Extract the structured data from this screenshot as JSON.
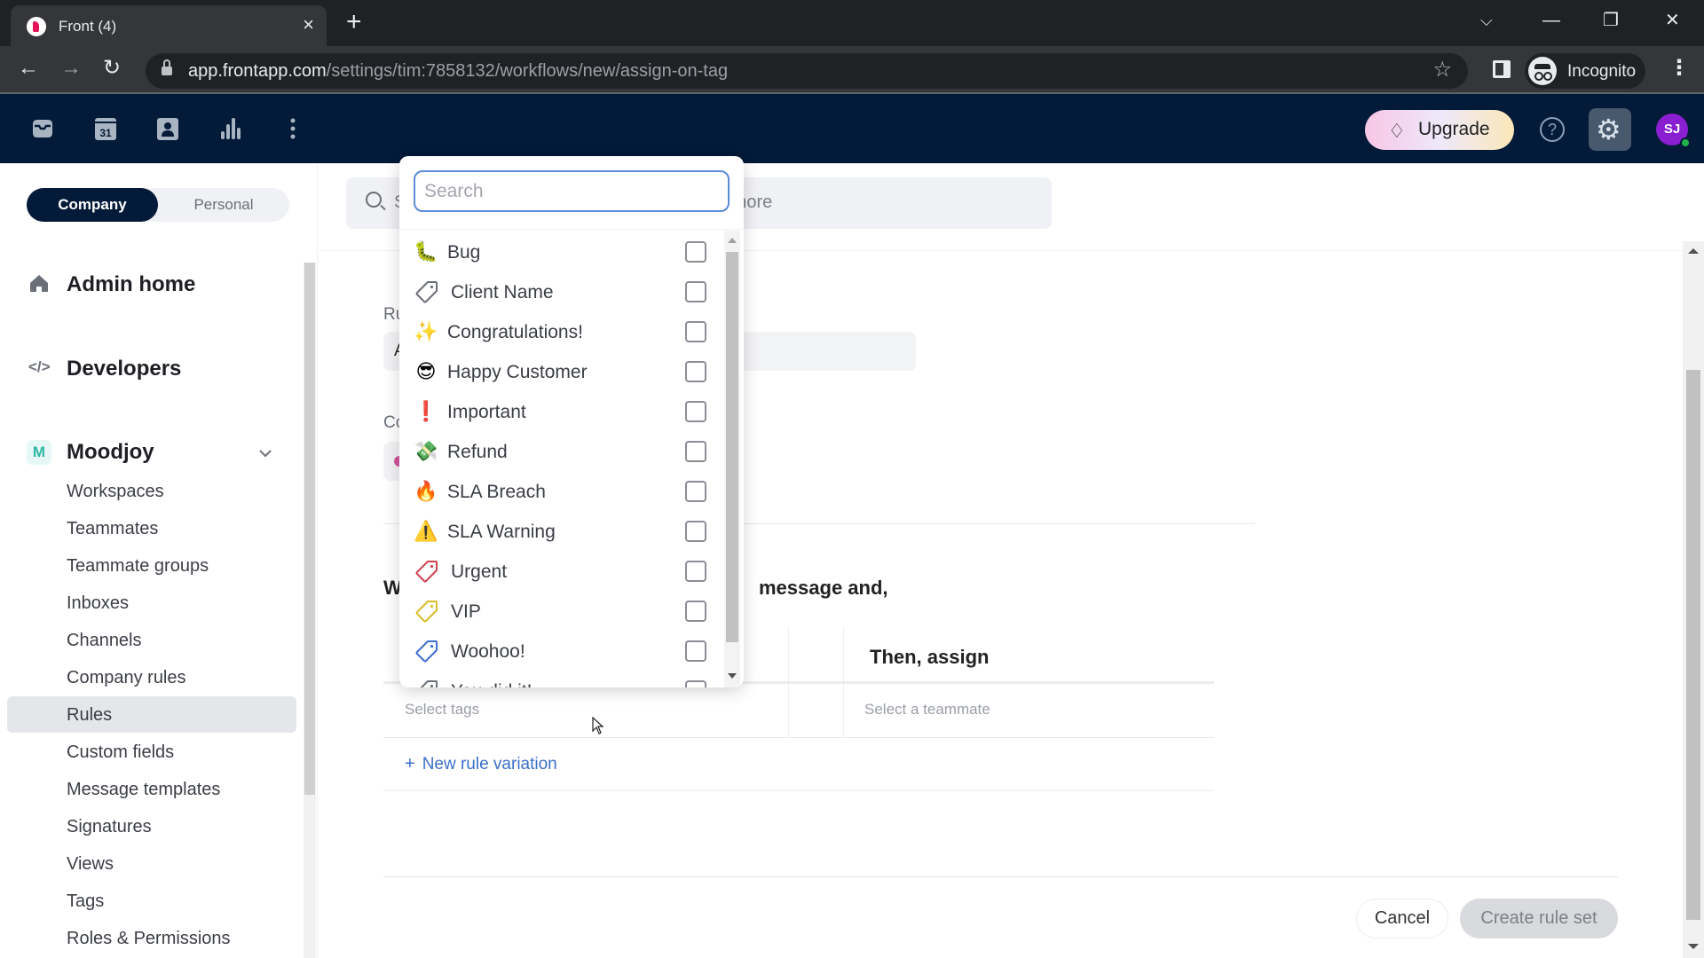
{
  "browser": {
    "tab_title": "Front (4)",
    "tab_close": "×",
    "new_tab": "+",
    "url_host": "app.frontapp.com",
    "url_path": "/settings/tim:7858132/workflows/new/assign-on-tag",
    "profile_label": "Incognito",
    "window_controls": {
      "tab_search": "⌵",
      "minimize": "—",
      "restore": "❐",
      "close": "✕"
    },
    "nav": {
      "back": "←",
      "forward": "→",
      "reload": "↻",
      "bookmark": "☆",
      "menu": "⋮"
    }
  },
  "app_nav": {
    "icons": [
      "inbox-icon",
      "calendar-icon",
      "contacts-icon",
      "analytics-icon",
      "more-icon"
    ],
    "calendar_day": "31",
    "upgrade_label": "Upgrade",
    "help_glyph": "?",
    "settings_glyph": "⚙",
    "avatar_initials": "SJ",
    "colors": {
      "nav_bg": "#031a38",
      "avatar_bg": "#8a1fd1",
      "online": "#1fb34a"
    }
  },
  "sidebar": {
    "scope_tabs": [
      {
        "label": "Company",
        "active": true
      },
      {
        "label": "Personal",
        "active": false
      }
    ],
    "admin_home": "Admin home",
    "developers": "Developers",
    "developers_glyph": "</>",
    "workspace": {
      "badge": "M",
      "name": "Moodjoy",
      "expanded": true
    },
    "items": [
      {
        "label": "Workspaces",
        "active": false
      },
      {
        "label": "Teammates",
        "active": false
      },
      {
        "label": "Teammate groups",
        "active": false
      },
      {
        "label": "Inboxes",
        "active": false
      },
      {
        "label": "Channels",
        "active": false
      },
      {
        "label": "Company rules",
        "active": false
      },
      {
        "label": "Rules",
        "active": true
      },
      {
        "label": "Custom fields",
        "active": false
      },
      {
        "label": "Message templates",
        "active": false
      },
      {
        "label": "Signatures",
        "active": false
      },
      {
        "label": "Views",
        "active": false
      },
      {
        "label": "Tags",
        "active": false
      },
      {
        "label": "Roles & Permissions",
        "active": false
      }
    ]
  },
  "main": {
    "search_placeholder_partial": "S",
    "search_placeholder_tail": "d more",
    "partial_labels": {
      "rule_name": "Ru",
      "rule_value": "A",
      "conditions": "Co",
      "when": "W"
    },
    "when_suffix": "message and,",
    "table": {
      "then_header": "Then, assign",
      "tags_placeholder": "Select tags",
      "teammate_placeholder": "Select a teammate"
    },
    "new_variation_plus": "+",
    "new_variation_label": "New rule variation",
    "cancel_label": "Cancel",
    "create_label": "Create rule set"
  },
  "tag_dropdown": {
    "search_placeholder": "Search",
    "search_value": "",
    "tags": [
      {
        "name": "Bug",
        "icon": "🐛",
        "icon_name": "bug-icon",
        "checked": false
      },
      {
        "name": "Client Name",
        "icon": "tag",
        "icon_name": "tag-icon",
        "color": "#6b6f78",
        "checked": false
      },
      {
        "name": "Congratulations!",
        "icon": "✨",
        "icon_name": "sparkles-icon",
        "checked": false
      },
      {
        "name": "Happy Customer",
        "icon": "😎",
        "icon_name": "sunglasses-face-icon",
        "checked": false
      },
      {
        "name": "Important",
        "icon": "❗",
        "icon_name": "exclamation-icon",
        "checked": false
      },
      {
        "name": "Refund",
        "icon": "💸",
        "icon_name": "money-wings-icon",
        "checked": false
      },
      {
        "name": "SLA Breach",
        "icon": "🔥",
        "icon_name": "fire-icon",
        "checked": false
      },
      {
        "name": "SLA Warning",
        "icon": "⚠️",
        "icon_name": "warning-icon",
        "checked": false
      },
      {
        "name": "Urgent",
        "icon": "tag",
        "icon_name": "tag-icon",
        "color": "#d0434f",
        "checked": false
      },
      {
        "name": "VIP",
        "icon": "tag",
        "icon_name": "tag-icon",
        "color": "#d9be2c",
        "checked": false
      },
      {
        "name": "Woohoo!",
        "icon": "tag",
        "icon_name": "tag-icon",
        "color": "#3d6fd1",
        "checked": false
      },
      {
        "name": "You did it!",
        "icon": "tag",
        "icon_name": "tag-icon",
        "color": "#6b6f78",
        "checked": false
      }
    ]
  }
}
